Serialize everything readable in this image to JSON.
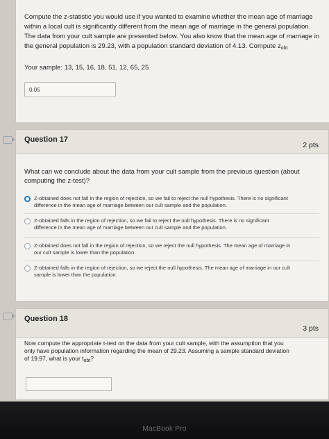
{
  "previous_question": {
    "lines": [
      "Compute the z-statistic you would use if you wanted to examine whether the mean age of marriage",
      "within a local cult is significantly different from the mean age of marriage in the general population.",
      "The data from your cult sample are presented below. You also know that the mean age of marriage in",
      "the general population is 29.23, with a population standard deviation of 4.13. Compute z"
    ],
    "z_sub": "obt",
    "sample": "Your sample: 13, 15, 16, 18, 51, 12, 65, 25",
    "answer_value": "0.05"
  },
  "question17": {
    "title": "Question 17",
    "points": "2 pts",
    "prompt_lines": [
      "What can we conclude about the data from your cult sample from the previous question (about",
      "computing the z-test)?"
    ],
    "options": [
      {
        "lines": [
          "Z-obtained does not fall in the region of rejection, so we fail to reject the null hypothesis. There is no significant",
          "difference in the mean age of marriage between our cult sample and the population."
        ],
        "selected": true
      },
      {
        "lines": [
          "Z-obtained falls in the region of rejection, so we fail to reject the null hypothesis. There is no significant",
          "difference in the mean age of marriage between our cult sample and the population."
        ],
        "selected": false
      },
      {
        "lines": [
          "Z-obtained does not fall in the region of rejection, so we reject the null hypothesis. The mean age of marriage in",
          "our cult sample is lower than the population."
        ],
        "selected": false
      },
      {
        "lines": [
          "Z-obtained falls in the region of rejection, so we reject the null hypothesis. The mean age of marriage in our cult",
          "sample is lower than the population."
        ],
        "selected": false
      }
    ]
  },
  "question18": {
    "title": "Question 18",
    "points": "3 pts",
    "prompt_lines": [
      "Now compute the appropriate t-test on the data from your cult sample, with the assumption that you",
      "only have population information regarding the mean of 29.23. Assuming a sample standard deviation",
      "of 19.97, what is your t"
    ],
    "t_sub": "obt",
    "t_suffix": "?",
    "answer_value": ""
  },
  "bezel": {
    "label": "MacBook Pro"
  }
}
